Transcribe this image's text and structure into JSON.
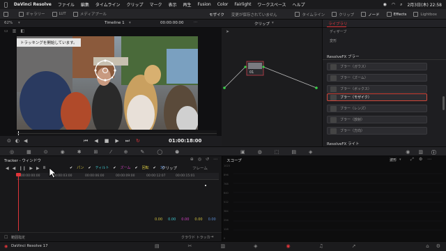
{
  "mac_menu": {
    "app": "DaVinci Resolve",
    "items": [
      "ファイル",
      "編集",
      "タイムライン",
      "クリップ",
      "マーク",
      "表示",
      "再生",
      "Fusion",
      "Color",
      "Fairlight",
      "ワークスペース",
      "ヘルプ"
    ],
    "clock": "2月3日(木) 22:58"
  },
  "toolbar": {
    "left_items": [
      "ギャラリー",
      "LUT",
      "メディアプール"
    ],
    "project_title": "モザイク",
    "unsaved_note": "変更が保存されていません",
    "right_items": [
      "タイムライン",
      "クリップ",
      "ノード",
      "Effects",
      "Lightbox"
    ]
  },
  "viewer": {
    "zoom": "62%",
    "timeline_name": "Timeline 1",
    "timecode": "00:00:00:00",
    "clip_menu": "クリップ",
    "tooltip": "トラッキングを開始しています。",
    "current_time": "01:00:18:00"
  },
  "node": {
    "label": "01"
  },
  "library": {
    "tab": "ライブラリ",
    "top_items": [
      "ディザーブ",
      "変形"
    ],
    "section_blur": "ResolveFX ブラー",
    "blur_items": [
      "ブラー（ガウス）",
      "ブラー（ズーム）",
      "ブラー（ボックス）",
      "ブラー（モザイク）",
      "ブラー（レンズ）",
      "ブラー（放射）",
      "ブラー（方向）"
    ],
    "selected_index": 3,
    "section_light": "ResolveFX ライト"
  },
  "tracker": {
    "title": "Tracker - ウィンドウ",
    "checks": [
      "パン",
      "ティルト",
      "ズーム",
      "回転",
      "3D"
    ],
    "mode_clip": "クリップ",
    "mode_frame": "フレーム",
    "ruler_labels": [
      "00:00:00:00",
      "00:00:03:00",
      "00:00:06:00",
      "00:00:09:00",
      "00:00:12:07",
      "00:00:15:01"
    ],
    "values": [
      "0.00",
      "0.00",
      "0.00",
      "0.00",
      "0.00"
    ],
    "footer_left": "範囲指定",
    "footer_right": "クラウド トラッカー"
  },
  "scope": {
    "title": "スコープ",
    "mode": "波形",
    "y_labels": [
      "1023",
      "896",
      "768",
      "640",
      "512",
      "384",
      "256",
      "128",
      "0"
    ]
  },
  "bottom": {
    "app_label": "DaVinci Resolve 17"
  },
  "colors": {
    "accent": "#d0463a",
    "playhead": "#e0353a",
    "tracker_blue": "#3a6ed9"
  }
}
